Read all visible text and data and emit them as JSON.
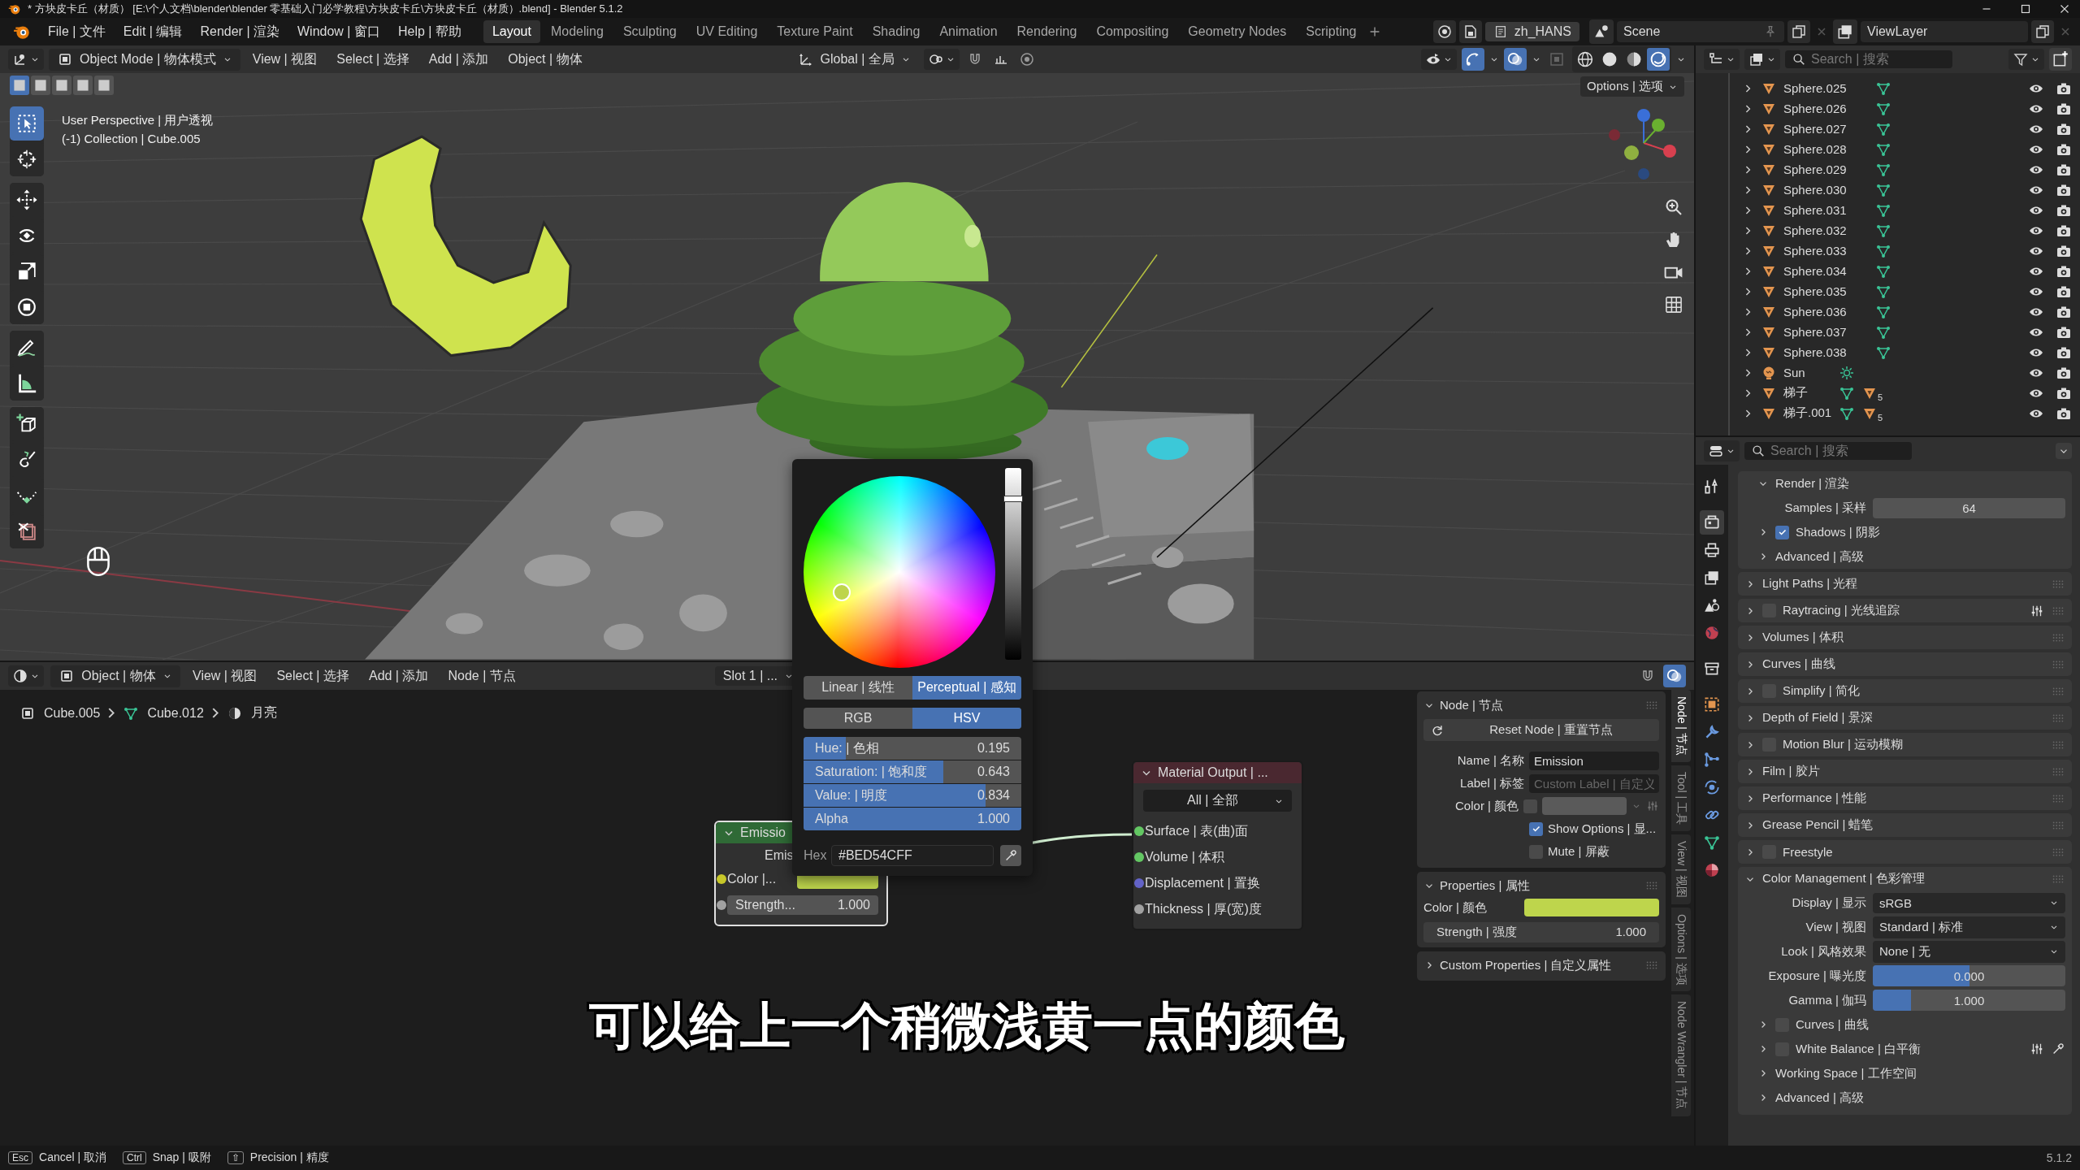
{
  "window": {
    "title": "* 方块皮卡丘（材质） [E:\\个人文档\\blender\\blender 零基础入门必学教程\\方块皮卡丘\\方块皮卡丘（材质）.blend] - Blender 5.1.2"
  },
  "menus": [
    "File | 文件",
    "Edit | 编辑",
    "Render | 渲染",
    "Window | 窗口",
    "Help | 帮助"
  ],
  "workspaces": [
    {
      "label": "Layout",
      "selected": true
    },
    {
      "label": "Modeling",
      "selected": false
    },
    {
      "label": "Sculpting",
      "selected": false
    },
    {
      "label": "UV Editing",
      "selected": false
    },
    {
      "label": "Texture Paint",
      "selected": false
    },
    {
      "label": "Shading",
      "selected": false
    },
    {
      "label": "Animation",
      "selected": false
    },
    {
      "label": "Rendering",
      "selected": false
    },
    {
      "label": "Compositing",
      "selected": false
    },
    {
      "label": "Geometry Nodes",
      "selected": false
    },
    {
      "label": "Scripting",
      "selected": false
    }
  ],
  "language": "zh_HANS",
  "scene": "Scene",
  "view_layer": "ViewLayer",
  "viewport": {
    "mode": "Object Mode | 物体模式",
    "menus": [
      "View | 视图",
      "Select | 选择",
      "Add | 添加",
      "Object | 物体"
    ],
    "orientation": "Global | 全局",
    "options": "Options | 选项",
    "view_name": "User Perspective | 用户透视",
    "collection": "(-1) Collection | Cube.005",
    "select_modes": [
      {
        "selected": true
      },
      {
        "selected": false
      },
      {
        "selected": false
      },
      {
        "selected": false
      },
      {
        "selected": false
      }
    ],
    "tool_groups": [
      {
        "tools": [
          {
            "kind": "select_box",
            "selected": true
          },
          {
            "kind": "cursor",
            "selected": false
          }
        ]
      },
      {
        "tools": [
          {
            "kind": "move",
            "selected": false
          },
          {
            "kind": "rotate",
            "selected": false
          },
          {
            "kind": "scale",
            "selected": false
          },
          {
            "kind": "transform",
            "selected": false
          }
        ]
      },
      {
        "tools": [
          {
            "kind": "annotate",
            "selected": false
          },
          {
            "kind": "measure",
            "selected": false
          }
        ]
      },
      {
        "tools": [
          {
            "kind": "add_cube",
            "selected": false
          },
          {
            "kind": "curl",
            "selected": false
          },
          {
            "kind": "dotted_curve",
            "selected": false
          },
          {
            "kind": "scissors",
            "selected": false
          }
        ]
      }
    ],
    "shading": [
      {
        "kind": "wireframe",
        "selected": false
      },
      {
        "kind": "solid",
        "selected": false
      },
      {
        "kind": "material",
        "selected": false
      },
      {
        "kind": "rendered",
        "selected": true
      }
    ]
  },
  "outliner": {
    "search_placeholder": "Search | 搜索",
    "items": [
      {
        "name": "Sphere.025",
        "kind": "mesh"
      },
      {
        "name": "Sphere.026",
        "kind": "mesh"
      },
      {
        "name": "Sphere.027",
        "kind": "mesh"
      },
      {
        "name": "Sphere.028",
        "kind": "mesh"
      },
      {
        "name": "Sphere.029",
        "kind": "mesh"
      },
      {
        "name": "Sphere.030",
        "kind": "mesh"
      },
      {
        "name": "Sphere.031",
        "kind": "mesh"
      },
      {
        "name": "Sphere.032",
        "kind": "mesh"
      },
      {
        "name": "Sphere.033",
        "kind": "mesh"
      },
      {
        "name": "Sphere.034",
        "kind": "mesh"
      },
      {
        "name": "Sphere.035",
        "kind": "mesh"
      },
      {
        "name": "Sphere.036",
        "kind": "mesh"
      },
      {
        "name": "Sphere.037",
        "kind": "mesh"
      },
      {
        "name": "Sphere.038",
        "kind": "mesh"
      },
      {
        "name": "Sun",
        "kind": "light"
      },
      {
        "name": "梯子",
        "kind": "mesh",
        "child_count": "5"
      },
      {
        "name": "梯子.001",
        "kind": "mesh",
        "child_count": "5"
      }
    ]
  },
  "properties": {
    "search_placeholder": "Search | 搜索",
    "tabs": [
      {
        "kind": "tool",
        "selected": false
      },
      {
        "kind": "render",
        "selected": true
      },
      {
        "kind": "output",
        "selected": false
      },
      {
        "kind": "view_layer",
        "selected": false
      },
      {
        "kind": "scene",
        "selected": false
      },
      {
        "kind": "world",
        "selected": false
      },
      {
        "kind": "collection",
        "selected": false
      },
      {
        "kind": "object",
        "selected": false
      },
      {
        "kind": "modifiers",
        "selected": false
      },
      {
        "kind": "particles",
        "selected": false
      },
      {
        "kind": "physics",
        "selected": false
      },
      {
        "kind": "constraints",
        "selected": false
      },
      {
        "kind": "data",
        "selected": false
      },
      {
        "kind": "material",
        "selected": false
      }
    ],
    "panels": [
      {
        "kind": "card",
        "children": [
          {
            "kind": "subpanel",
            "label": "Render | 渲染",
            "expanded": true,
            "children": [
              {
                "kind": "number",
                "label": "Samples | 采样",
                "value": "64"
              }
            ]
          },
          {
            "kind": "subpanel",
            "label": "Shadows | 阴影",
            "expanded": false,
            "checked": true
          },
          {
            "kind": "subpanel",
            "label": "Advanced | 高级",
            "expanded": false
          }
        ]
      },
      {
        "kind": "panel",
        "label": "Light Paths | 光程",
        "expanded": false
      },
      {
        "kind": "panel",
        "label": "Raytracing | 光线追踪",
        "expanded": false,
        "checked": false,
        "presets": true
      },
      {
        "kind": "panel",
        "label": "Volumes | 体积",
        "expanded": false
      },
      {
        "kind": "panel",
        "label": "Curves | 曲线",
        "expanded": false
      },
      {
        "kind": "panel",
        "label": "Simplify | 简化",
        "expanded": false,
        "checked": false
      },
      {
        "kind": "panel",
        "label": "Depth of Field | 景深",
        "expanded": false
      },
      {
        "kind": "panel",
        "label": "Motion Blur | 运动模糊",
        "expanded": false,
        "checked": false
      },
      {
        "kind": "panel",
        "label": "Film | 胶片",
        "expanded": false
      },
      {
        "kind": "panel",
        "label": "Performance | 性能",
        "expanded": false
      },
      {
        "kind": "panel",
        "label": "Grease Pencil | 蜡笔",
        "expanded": false
      },
      {
        "kind": "panel",
        "label": "Freestyle",
        "expanded": false,
        "checked": false
      },
      {
        "kind": "panel",
        "label": "Color Management | 色彩管理",
        "expanded": true,
        "children": [
          {
            "kind": "dropdown",
            "label": "Display | 显示",
            "value": "sRGB"
          },
          {
            "kind": "dropdown",
            "label": "View | 视图",
            "value": "Standard | 标准"
          },
          {
            "kind": "dropdown",
            "label": "Look | 风格效果",
            "value": "None | 无"
          },
          {
            "kind": "slider",
            "label": "Exposure | 曝光度",
            "value": "0.000",
            "level": 0.5
          },
          {
            "kind": "slider",
            "label": "Gamma | 伽玛",
            "value": "1.000",
            "level": 0.2
          },
          {
            "kind": "subpanel",
            "label": "Curves | 曲线",
            "expanded": false,
            "checked": false
          },
          {
            "kind": "subpanel",
            "label": "White Balance | 白平衡",
            "expanded": false,
            "checked": false,
            "presets": true,
            "eyedropper": true
          },
          {
            "kind": "subpanel",
            "label": "Working Space | 工作空间",
            "expanded": false
          },
          {
            "kind": "subpanel",
            "label": "Advanced | 高级",
            "expanded": false
          }
        ]
      }
    ]
  },
  "node_editor": {
    "object_mode": "Object | 物体",
    "menus": [
      "View | 视图",
      "Select | 选择",
      "Add | 添加",
      "Node | 节点"
    ],
    "slot": "Slot 1 | ...",
    "breadcrumbs": [
      {
        "kind": "object",
        "label": "Cube.005"
      },
      {
        "kind": "mesh",
        "label": "Cube.012"
      },
      {
        "kind": "material",
        "label": "月亮"
      }
    ],
    "nodes": [
      {
        "kind": "emission",
        "title": "Emissio",
        "selected": true,
        "output": "Emis",
        "inputs": [
          {
            "kind": "color",
            "label": "Color |...",
            "color": "#bed54c"
          },
          {
            "kind": "number",
            "label": "Strength...",
            "value": "1.000"
          }
        ]
      },
      {
        "kind": "output",
        "title": "Material Output | ...",
        "selected": false,
        "target": "All | 全部",
        "inputs": [
          {
            "kind": "socket",
            "label": "Surface | 表(曲)面",
            "color": "#63c763"
          },
          {
            "kind": "socket",
            "label": "Volume | 体积",
            "color": "#63c763"
          },
          {
            "kind": "socket",
            "label": "Displacement | 置换",
            "color": "#6363c7"
          },
          {
            "kind": "socket",
            "label": "Thickness | 厚(宽)度",
            "color": "#a1a1a1"
          }
        ]
      }
    ],
    "sidebar": {
      "tabs": [
        {
          "label": "Node | 节点",
          "selected": true
        },
        {
          "label": "Tool | 工具",
          "selected": false
        },
        {
          "label": "View | 视图",
          "selected": false
        },
        {
          "label": "Options | 选项",
          "selected": false
        },
        {
          "label": "Node Wrangler | 节点",
          "selected": false
        }
      ],
      "node_panel": {
        "title": "Node | 节点",
        "reset": "Reset Node | 重置节点",
        "name_label": "Name | 名称",
        "name": "Emission",
        "label_label": "Label | 标签",
        "label_placeholder": "Custom Label | 自定义",
        "color_label": "Color | 颜色",
        "use_color": false,
        "show_options": {
          "label": "Show Options | 显...",
          "checked": true
        },
        "mute": {
          "label": "Mute | 屏蔽",
          "checked": false
        }
      },
      "properties_panel": {
        "title": "Properties | 属性",
        "color_label": "Color | 颜色",
        "color": "#bed54c",
        "strength_label": "Strength | 强度",
        "strength": "1.000"
      },
      "custom_panel": {
        "title": "Custom Properties | 自定义属性",
        "expanded": false
      }
    }
  },
  "color_picker": {
    "modes": [
      {
        "label": "Linear | 线性",
        "selected": false
      },
      {
        "label": "Perceptual | 感知",
        "selected": true
      }
    ],
    "models": [
      {
        "label": "RGB",
        "selected": false
      },
      {
        "label": "HSV",
        "selected": true
      }
    ],
    "sliders": [
      {
        "label": "Hue: | 色相",
        "value": "0.195",
        "level": 0.195
      },
      {
        "label": "Saturation: | 饱和度",
        "value": "0.643",
        "level": 0.643
      },
      {
        "label": "Value: | 明度",
        "value": "0.834",
        "level": 0.834
      },
      {
        "label": "Alpha",
        "value": "1.000",
        "level": 1
      }
    ],
    "hex_label": "Hex",
    "hex": "#BED54CFF"
  },
  "subtitle": "可以给上一个稍微浅黄一点的颜色",
  "status": [
    {
      "key": "Esc",
      "label": "Cancel | 取消"
    },
    {
      "key": "Ctrl",
      "label": "Snap | 吸附"
    },
    {
      "key": "⇧",
      "label": "Precision | 精度"
    }
  ],
  "version": "5.1.2"
}
